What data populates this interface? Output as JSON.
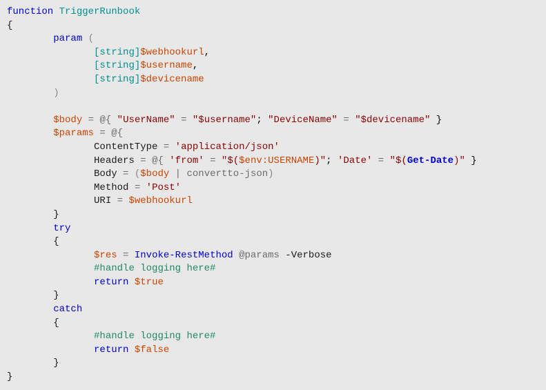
{
  "code": {
    "l1_function": "function",
    "l1_name": "TriggerRunbook",
    "l2_brace": "{",
    "l3_param": "param",
    "l3_paren_open": "(",
    "l4_type": "[string]",
    "l4_var": "$webhookurl",
    "l4_comma": ",",
    "l5_type": "[string]",
    "l5_var": "$username",
    "l5_comma": ",",
    "l6_type": "[string]",
    "l6_var": "$devicename",
    "l7_paren_close": ")",
    "l9_var": "$body",
    "l9_eq": " = ",
    "l9_at": "@{",
    "l9_key1": "\"UserName\"",
    "l9_eq2": " = ",
    "l9_val1": "\"$username\"",
    "l9_semi": ";",
    "l9_key2": "\"DeviceName\"",
    "l9_eq3": " = ",
    "l9_val2": "\"$devicename\"",
    "l9_close": " }",
    "l10_var": "$params",
    "l10_eq": " = ",
    "l10_at": "@{",
    "l11_key": "ContentType",
    "l11_eq": " = ",
    "l11_val": "'application/json'",
    "l12_key": "Headers",
    "l12_eq": " = ",
    "l12_at": "@{",
    "l12_key1": "'from'",
    "l12_eq2": " = ",
    "l12_val1a": "\"$(",
    "l12_val1b": "$env:USERNAME",
    "l12_val1c": ")\"",
    "l12_semi": ";",
    "l12_key2": "'Date'",
    "l12_eq3": " = ",
    "l12_val2a": "\"$(",
    "l12_val2b": "Get-Date",
    "l12_val2c": ")\"",
    "l12_close": " }",
    "l13_key": "Body",
    "l13_eq": " = ",
    "l13_open": "(",
    "l13_var": "$body",
    "l13_pipe": " | ",
    "l13_cmd": "convertto-json",
    "l13_close": ")",
    "l14_key": "Method",
    "l14_eq": " = ",
    "l14_val": "'Post'",
    "l15_key": "URI",
    "l15_eq": " = ",
    "l15_var": "$webhookurl",
    "l16_close": "}",
    "l17_try": "try",
    "l18_brace": "{",
    "l19_var": "$res",
    "l19_eq": " = ",
    "l19_cmd": "Invoke-RestMethod",
    "l19_param": "@params",
    "l19_flag": " -Verbose",
    "l20_comment": "#handle logging here#",
    "l21_return": "return",
    "l21_val": "$true",
    "l22_close": "}",
    "l23_catch": "catch",
    "l24_brace": "{",
    "l25_comment": "#handle logging here#",
    "l26_return": "return",
    "l26_val": "$false",
    "l27_close": "}",
    "l28_close": "}"
  }
}
